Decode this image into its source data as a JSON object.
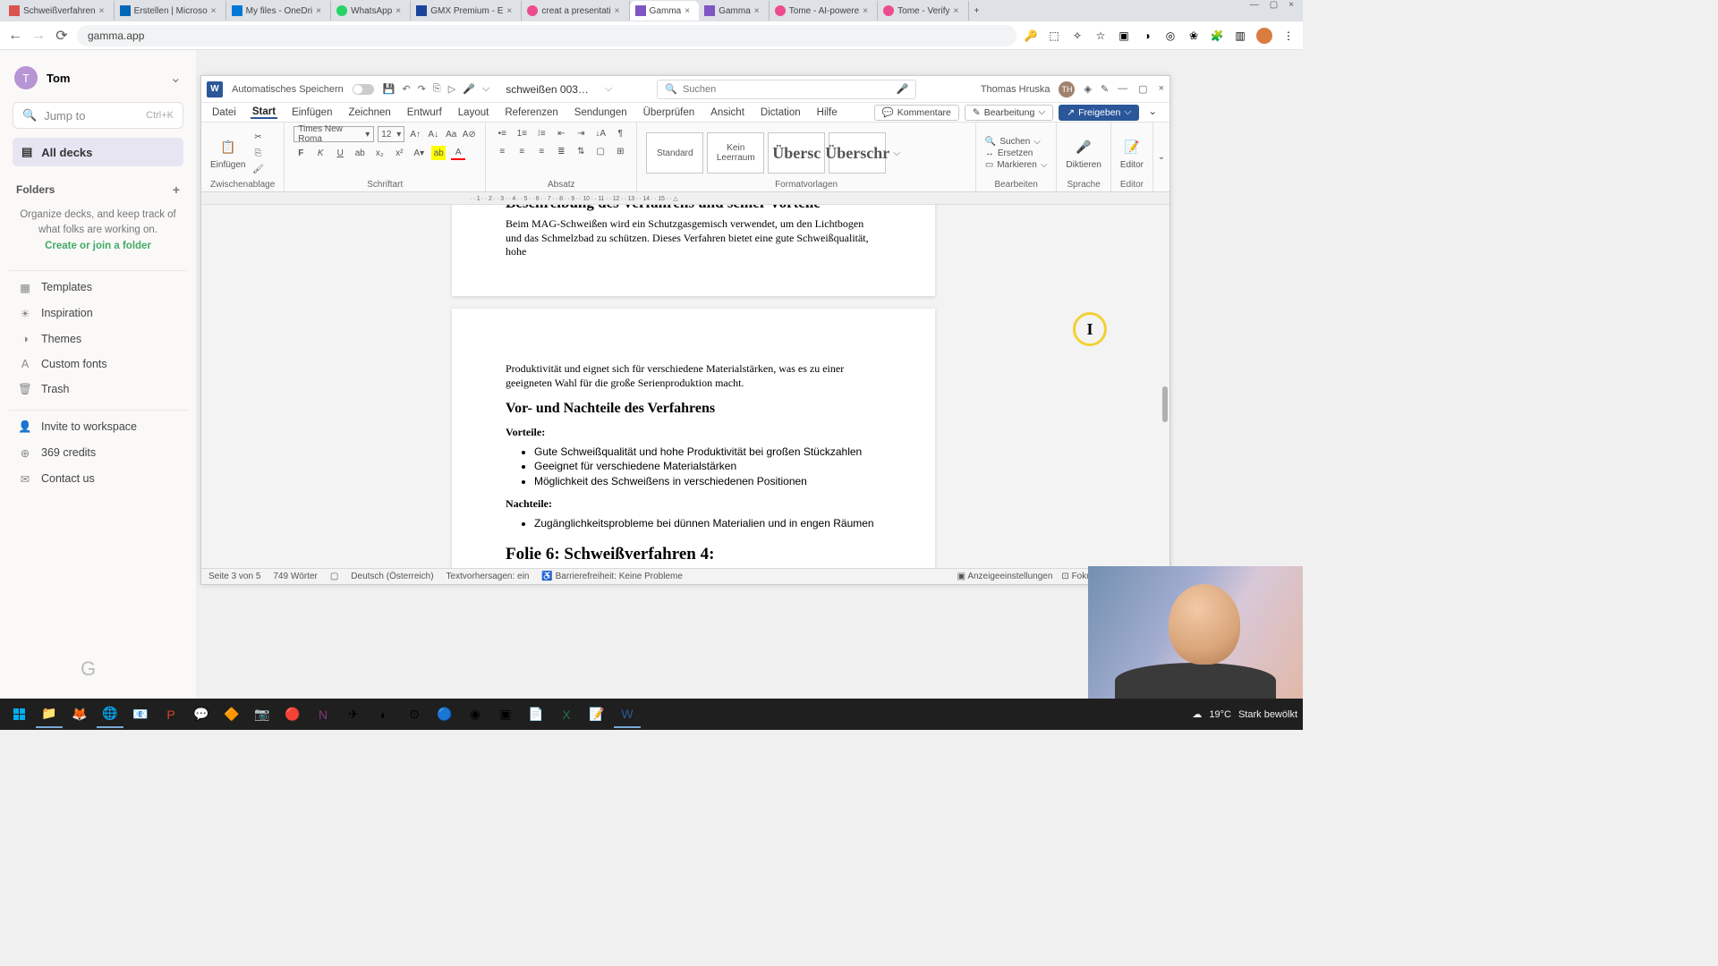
{
  "browser": {
    "tabs": [
      {
        "title": "Schweißverfahren"
      },
      {
        "title": "Erstellen | Microso"
      },
      {
        "title": "My files - OneDri"
      },
      {
        "title": "WhatsApp"
      },
      {
        "title": "GMX Premium - E"
      },
      {
        "title": "creat a presentati"
      },
      {
        "title": "Gamma"
      },
      {
        "title": "Gamma"
      },
      {
        "title": "Tome - AI-powere"
      },
      {
        "title": "Tome - Verify"
      }
    ],
    "url": "gamma.app"
  },
  "gamma": {
    "user": "Tom",
    "jump_placeholder": "Jump to",
    "jump_shortcut": "Ctrl+K",
    "all_decks": "All decks",
    "folders_label": "Folders",
    "folders_help1": "Organize decks, and keep track of what folks are working on.",
    "folders_cta": "Create or join a folder",
    "items": {
      "templates": "Templates",
      "inspiration": "Inspiration",
      "themes": "Themes",
      "custom_fonts": "Custom fonts",
      "trash": "Trash",
      "invite": "Invite to workspace",
      "credits": "369 credits",
      "contact": "Contact us"
    }
  },
  "word": {
    "autosave_label": "Automatisches Speichern",
    "doc_name": "schweißen 003…",
    "search_placeholder": "Suchen",
    "user_name": "Thomas Hruska",
    "user_initials": "TH",
    "tabs": {
      "datei": "Datei",
      "start": "Start",
      "einfuegen": "Einfügen",
      "zeichnen": "Zeichnen",
      "entwurf": "Entwurf",
      "layout": "Layout",
      "referenzen": "Referenzen",
      "sendungen": "Sendungen",
      "ueberpruefen": "Überprüfen",
      "ansicht": "Ansicht",
      "dictation": "Dictation",
      "hilfe": "Hilfe"
    },
    "top_buttons": {
      "kommentare": "Kommentare",
      "bearbeitung": "Bearbeitung",
      "freigeben": "Freigeben"
    },
    "ribbon": {
      "zwischenablage": "Zwischenablage",
      "einfuegen": "Einfügen",
      "schriftart": "Schriftart",
      "font_name": "Times New Roma",
      "font_size": "12",
      "absatz": "Absatz",
      "formatvorlagen": "Formatvorlagen",
      "style_standard": "Standard",
      "style_kein": "Kein Leerraum",
      "style_h1": "Übersc",
      "style_h2": "Überschr",
      "bearbeiten": "Bearbeiten",
      "suchen": "Suchen",
      "ersetzen": "Ersetzen",
      "markieren": "Markieren",
      "sprache": "Sprache",
      "diktieren": "Diktieren",
      "editor": "Editor"
    },
    "document": {
      "h1": "Beschreibung des Verfahrens und seiner Vorteile",
      "p1": "Beim MAG-Schweißen wird ein Schutzgasgemisch verwendet, um den Lichtbogen und das Schmelzbad zu schützen. Dieses Verfahren bietet eine gute Schweißqualität, hohe",
      "p2": "Produktivität und eignet sich für verschiedene Materialstärken, was es zu einer geeigneten Wahl für die große Serienproduktion macht.",
      "h2": "Vor- und Nachteile des Verfahrens",
      "vorteile_label": "Vorteile:",
      "vorteile": [
        "Gute Schweißqualität und hohe Produktivität bei großen Stückzahlen",
        "Geeignet für verschiedene Materialstärken",
        "Möglichkeit des Schweißens in verschiedenen Positionen"
      ],
      "nachteile_label": "Nachteile:",
      "nachteile": [
        "Zugänglichkeitsprobleme bei dünnen Materialien und in engen Räumen"
      ],
      "h3": "Folie 6: Schweißverfahren 4:"
    },
    "status": {
      "page": "Seite 3 von 5",
      "words": "749 Wörter",
      "lang": "Deutsch (Österreich)",
      "predict": "Textvorhersagen: ein",
      "access": "Barrierefreiheit: Keine Probleme",
      "display": "Anzeigeeinstellungen",
      "fokus": "Fokus"
    }
  },
  "taskbar": {
    "temp": "19°C",
    "weather": "Stark bewölkt"
  }
}
